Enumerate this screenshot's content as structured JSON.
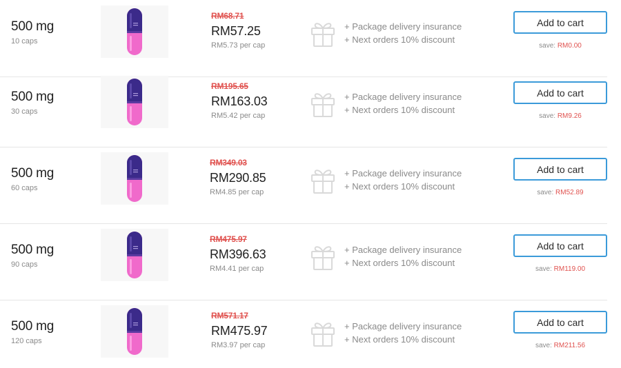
{
  "colors": {
    "strike_price": "#e0524f",
    "button_border": "#3a9ad9",
    "capsule_top": "#3b2a8a",
    "capsule_bottom": "#f06acb"
  },
  "icons": {
    "pill": "capsule-icon",
    "gift": "gift-box-icon"
  },
  "rows": [
    {
      "dose": "500 mg",
      "count": "10 caps",
      "old_price": "RM68.71",
      "new_price": "RM57.25",
      "per_cap": "RM5.73 per cap",
      "perk_1": "+ Package delivery insurance",
      "perk_2": "+ Next orders 10% discount",
      "button_label": "Add to cart",
      "save_label": "save:",
      "save_value": "RM0.00"
    },
    {
      "dose": "500 mg",
      "count": "30 caps",
      "old_price": "RM195.65",
      "new_price": "RM163.03",
      "per_cap": "RM5.42 per cap",
      "perk_1": "+ Package delivery insurance",
      "perk_2": "+ Next orders 10% discount",
      "button_label": "Add to cart",
      "save_label": "save:",
      "save_value": "RM9.26"
    },
    {
      "dose": "500 mg",
      "count": "60 caps",
      "old_price": "RM349.03",
      "new_price": "RM290.85",
      "per_cap": "RM4.85 per cap",
      "perk_1": "+ Package delivery insurance",
      "perk_2": "+ Next orders 10% discount",
      "button_label": "Add to cart",
      "save_label": "save:",
      "save_value": "RM52.89"
    },
    {
      "dose": "500 mg",
      "count": "90 caps",
      "old_price": "RM475.97",
      "new_price": "RM396.63",
      "per_cap": "RM4.41 per cap",
      "perk_1": "+ Package delivery insurance",
      "perk_2": "+ Next orders 10% discount",
      "button_label": "Add to cart",
      "save_label": "save:",
      "save_value": "RM119.00"
    },
    {
      "dose": "500 mg",
      "count": "120 caps",
      "old_price": "RM571.17",
      "new_price": "RM475.97",
      "per_cap": "RM3.97 per cap",
      "perk_1": "+ Package delivery insurance",
      "perk_2": "+ Next orders 10% discount",
      "button_label": "Add to cart",
      "save_label": "save:",
      "save_value": "RM211.56"
    }
  ]
}
